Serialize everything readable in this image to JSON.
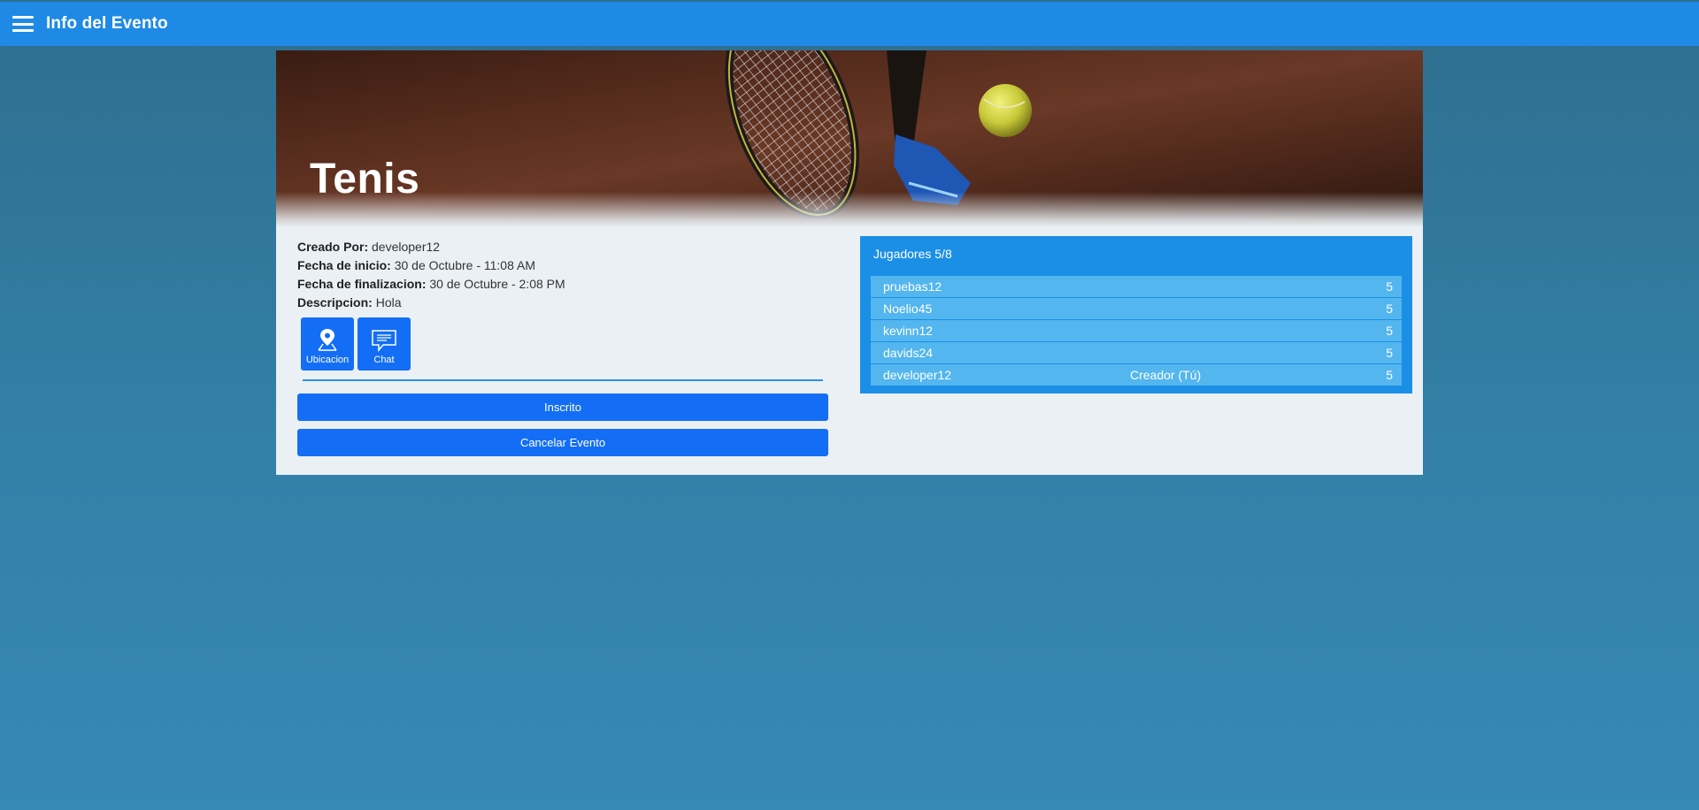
{
  "header": {
    "title": "Info del Evento",
    "menu_icon": "hamburger-menu-icon"
  },
  "event": {
    "title": "Tenis",
    "created_by_label": "Creado Por:",
    "created_by": "developer12",
    "start_label": "Fecha de inicio:",
    "start": "30 de Octubre - 11:08 AM",
    "end_label": "Fecha de finalizacion:",
    "end": "30 de Octubre - 2:08 PM",
    "description_label": "Descripcion:",
    "description": "Hola"
  },
  "actions": {
    "location_label": "Ubicacion",
    "location_icon": "map-pin-icon",
    "chat_label": "Chat",
    "chat_icon": "chat-bubble-icon",
    "inscrito_label": "Inscrito",
    "cancel_label": "Cancelar Evento"
  },
  "players": {
    "title": "Jugadores 5/8",
    "list": [
      {
        "name": "pruebas12",
        "role": "",
        "score": "5"
      },
      {
        "name": "Noelio45",
        "role": "",
        "score": "5"
      },
      {
        "name": "kevinn12",
        "role": "",
        "score": "5"
      },
      {
        "name": "davids24",
        "role": "",
        "score": "5"
      },
      {
        "name": "developer12",
        "role": "Creador (Tú)",
        "score": "5"
      }
    ]
  },
  "colors": {
    "topbar": "#1e8ae6",
    "primary_button": "#136ef5",
    "players_panel": "#1b8fe6",
    "player_row": "#53b6ee"
  }
}
